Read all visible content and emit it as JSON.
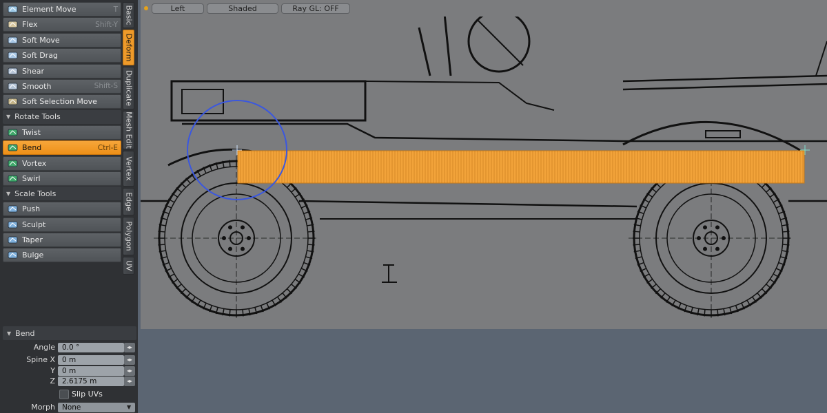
{
  "tools": {
    "deform_tools": [
      {
        "label": "Element Move",
        "shortcut": "T",
        "icon": "element-move-icon"
      },
      {
        "label": "Flex",
        "shortcut": "Shift-Y",
        "icon": "flex-icon"
      },
      {
        "label": "Soft Move",
        "shortcut": "",
        "icon": "soft-move-icon"
      },
      {
        "label": "Soft Drag",
        "shortcut": "",
        "icon": "soft-drag-icon"
      },
      {
        "label": "Shear",
        "shortcut": "",
        "icon": "shear-icon"
      },
      {
        "label": "Smooth",
        "shortcut": "Shift-S",
        "icon": "smooth-icon"
      },
      {
        "label": "Soft Selection Move",
        "shortcut": "",
        "icon": "soft-selection-move-icon"
      }
    ],
    "rotate_section": "Rotate Tools",
    "rotate_tools": [
      {
        "label": "Twist",
        "shortcut": "",
        "icon": "twist-icon"
      },
      {
        "label": "Bend",
        "shortcut": "Ctrl-E",
        "icon": "bend-icon",
        "active": true
      },
      {
        "label": "Vortex",
        "shortcut": "",
        "icon": "vortex-icon"
      },
      {
        "label": "Swirl",
        "shortcut": "",
        "icon": "swirl-icon"
      }
    ],
    "scale_section": "Scale Tools",
    "scale_tools": [
      {
        "label": "Push",
        "shortcut": "",
        "icon": "push-icon"
      },
      {
        "label": "Sculpt",
        "shortcut": "",
        "icon": "sculpt-icon"
      },
      {
        "label": "Taper",
        "shortcut": "",
        "icon": "taper-icon"
      },
      {
        "label": "Bulge",
        "shortcut": "",
        "icon": "bulge-icon"
      }
    ]
  },
  "vertical_tabs": [
    {
      "label": "Basic"
    },
    {
      "label": "Deform",
      "active": true
    },
    {
      "label": "Duplicate"
    },
    {
      "label": "Mesh Edit"
    },
    {
      "label": "Vertex"
    },
    {
      "label": "Edge"
    },
    {
      "label": "Polygon"
    },
    {
      "label": "UV"
    }
  ],
  "properties": {
    "title": "Bend",
    "angle_label": "Angle",
    "angle_value": "0.0 °",
    "spine_x_label": "Spine X",
    "spine_x_value": "0 m",
    "spine_y_label": "Y",
    "spine_y_value": "0 m",
    "spine_z_label": "Z",
    "spine_z_value": "2.6175 m",
    "slip_uvs_label": "Slip UVs",
    "slip_uvs_checked": false,
    "morph_label": "Morph",
    "morph_value": "None"
  },
  "viewport": {
    "view_label": "Left",
    "shading_label": "Shaded",
    "raygl_label": "Ray GL: OFF",
    "accent_color": "#f2a33a",
    "handle_color": "#3a57e0"
  },
  "colors": {
    "panel_bg": "#2f3134",
    "active_orange": "#ee9a2a",
    "viewport_bg": "#7b7c7e",
    "outer_bg": "#5b6572"
  }
}
